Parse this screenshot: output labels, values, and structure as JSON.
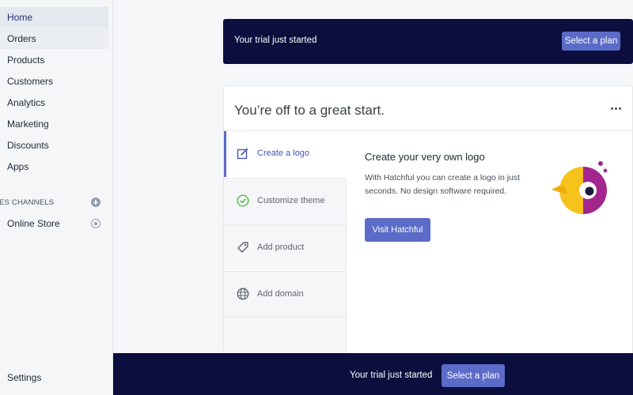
{
  "sidebar": {
    "items": [
      {
        "label": "Home"
      },
      {
        "label": "Orders"
      },
      {
        "label": "Products"
      },
      {
        "label": "Customers"
      },
      {
        "label": "Analytics"
      },
      {
        "label": "Marketing"
      },
      {
        "label": "Discounts"
      },
      {
        "label": "Apps"
      }
    ],
    "sales_channels_title": "ES CHANNELS",
    "online_store_label": "Online Store",
    "settings_label": "Settings"
  },
  "top_banner": {
    "text": "Your trial just started",
    "button_label": "Select a plan"
  },
  "card": {
    "title": "You’re off to a great start.",
    "steps": [
      {
        "label": "Create a logo",
        "icon": "edit-icon",
        "active": true
      },
      {
        "label": "Customize theme",
        "icon": "check-circle-icon",
        "active": false
      },
      {
        "label": "Add product",
        "icon": "tag-icon",
        "active": false
      },
      {
        "label": "Add domain",
        "icon": "globe-icon",
        "active": false
      }
    ],
    "content": {
      "title": "Create your very own logo",
      "description": "With Hatchful you can create a logo in just seconds. No design software required.",
      "button_label": "Visit Hatchful"
    }
  },
  "bottom_banner": {
    "text": "Your trial just started",
    "button_label": "Select a plan"
  },
  "colors": {
    "banner_bg": "#0c0e3e",
    "accent": "#5b6bc8",
    "active_text": "#202e78",
    "success": "#50b83c"
  }
}
